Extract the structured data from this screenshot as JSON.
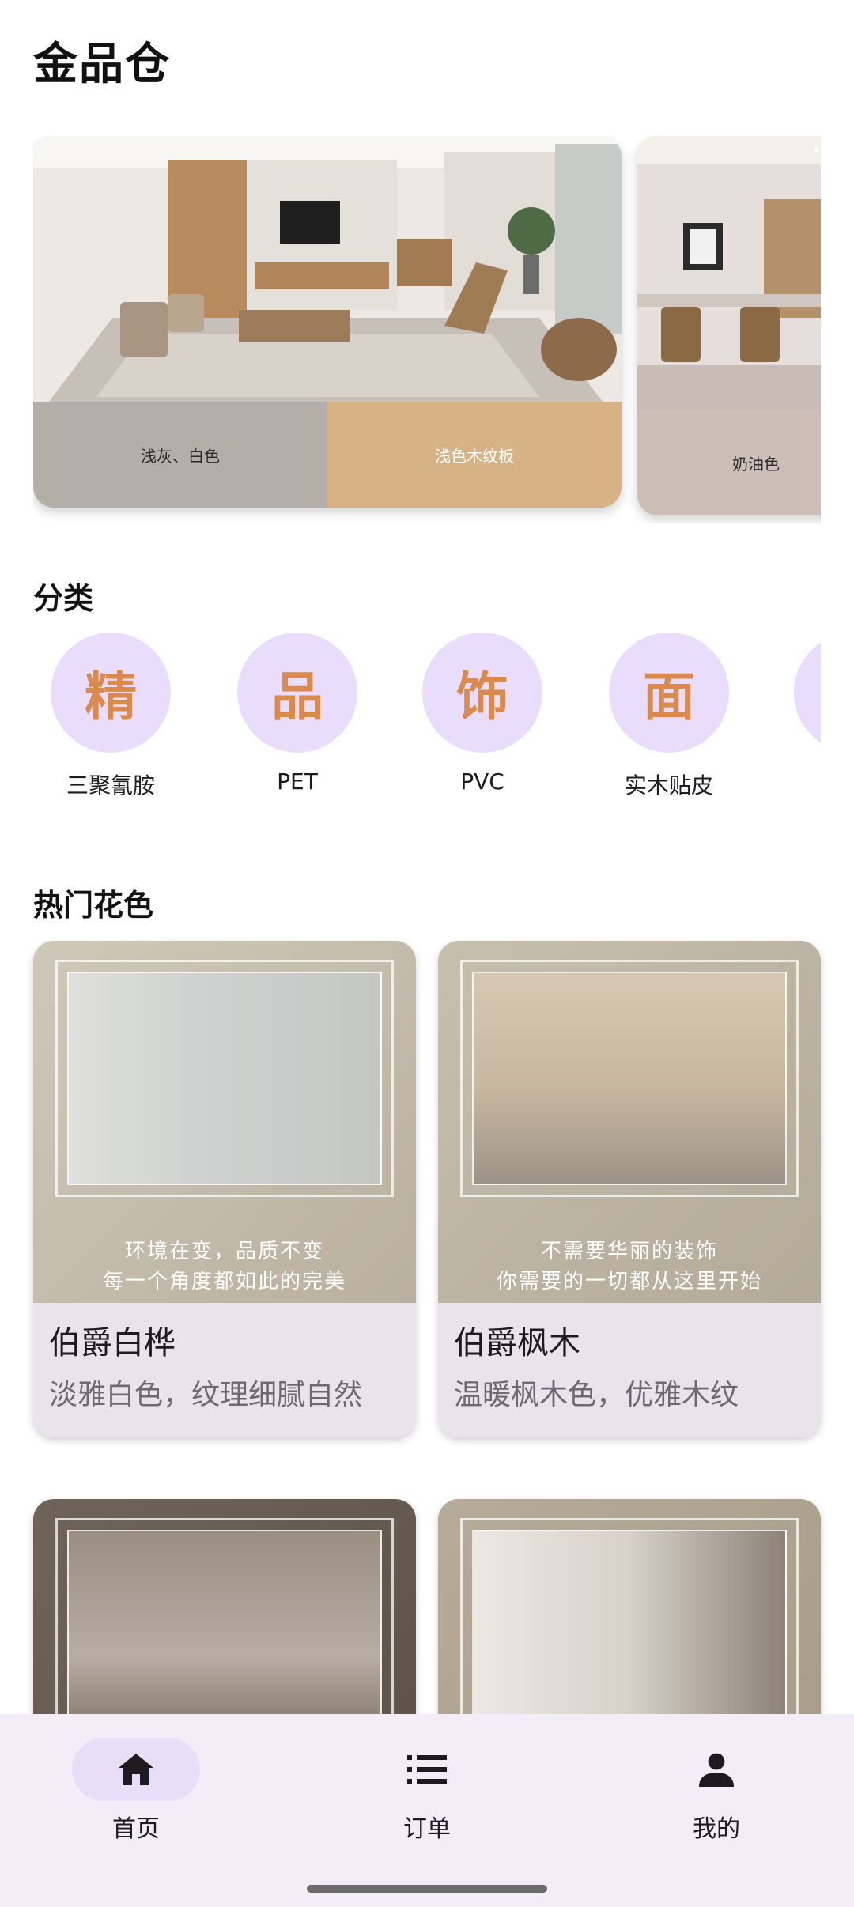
{
  "app": {
    "title": "金品仓"
  },
  "banners": [
    {
      "swatches": [
        {
          "label": "浅灰、白色",
          "color": "#b3aea8"
        },
        {
          "label": "浅色木纹板",
          "color": "#d6b284"
        }
      ]
    },
    {
      "swatches": [
        {
          "label": "奶油色",
          "color": "#cdbfb8"
        }
      ],
      "more": "••••"
    }
  ],
  "categories": {
    "title": "分类",
    "items": [
      {
        "glyph": "精",
        "label": "三聚氰胺"
      },
      {
        "glyph": "品",
        "label": "PET"
      },
      {
        "glyph": "饰",
        "label": "PVC"
      },
      {
        "glyph": "面",
        "label": "实木贴皮"
      },
      {
        "glyph": "",
        "label": ""
      }
    ]
  },
  "hot": {
    "title": "热门花色",
    "products": [
      {
        "name": "伯爵白桦",
        "desc": "淡雅白色，纹理细腻自然",
        "slogan1": "环境在变，品质不变",
        "slogan2": "每一个角度都如此的完美"
      },
      {
        "name": "伯爵枫木",
        "desc": "温暖枫木色，优雅木纹",
        "slogan1": "不需要华丽的装饰",
        "slogan2": "你需要的一切都从这里开始"
      },
      {
        "name": "",
        "desc": ""
      },
      {
        "name": "",
        "desc": ""
      }
    ]
  },
  "nav": {
    "items": [
      {
        "label": "首页",
        "icon": "home-icon",
        "active": true
      },
      {
        "label": "订单",
        "icon": "list-icon",
        "active": false
      },
      {
        "label": "我的",
        "icon": "person-icon",
        "active": false
      }
    ]
  },
  "colors": {
    "accent": "#d98a4c",
    "category_bg": "#eadcfb",
    "nav_bg": "#f3edf7",
    "nav_active": "#e8def8"
  }
}
